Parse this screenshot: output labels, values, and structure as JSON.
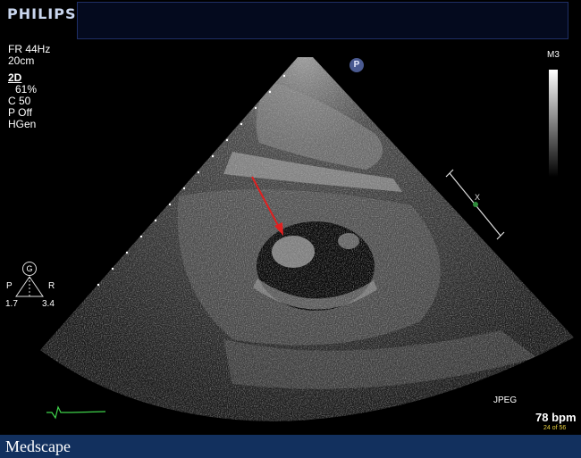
{
  "header": {
    "brand": "PHILIPS"
  },
  "params": {
    "frame_rate": "FR 44Hz",
    "depth": "20cm",
    "mode": "2D",
    "gain": "61%",
    "compression": "C 50",
    "power": "P Off",
    "harmonic": "HGen"
  },
  "probe_marker": "P",
  "grayscale_label": "M3",
  "orientation": {
    "glyph": "G",
    "left_label": "P",
    "right_label": "R",
    "left_value": "1.7",
    "right_value": "3.4"
  },
  "focus_marker": "X",
  "status": {
    "format": "JPEG",
    "heart_rate": "78 bpm",
    "frame_counter": "24 of 56"
  },
  "footer": {
    "logo": "Medscape"
  },
  "colors": {
    "annotation_arrow": "#e02020",
    "ecg_trace": "#3fd24a",
    "focus_dot": "#2e8b3a",
    "footer_bg": "#12305e",
    "frame_counter": "#e8d040"
  }
}
